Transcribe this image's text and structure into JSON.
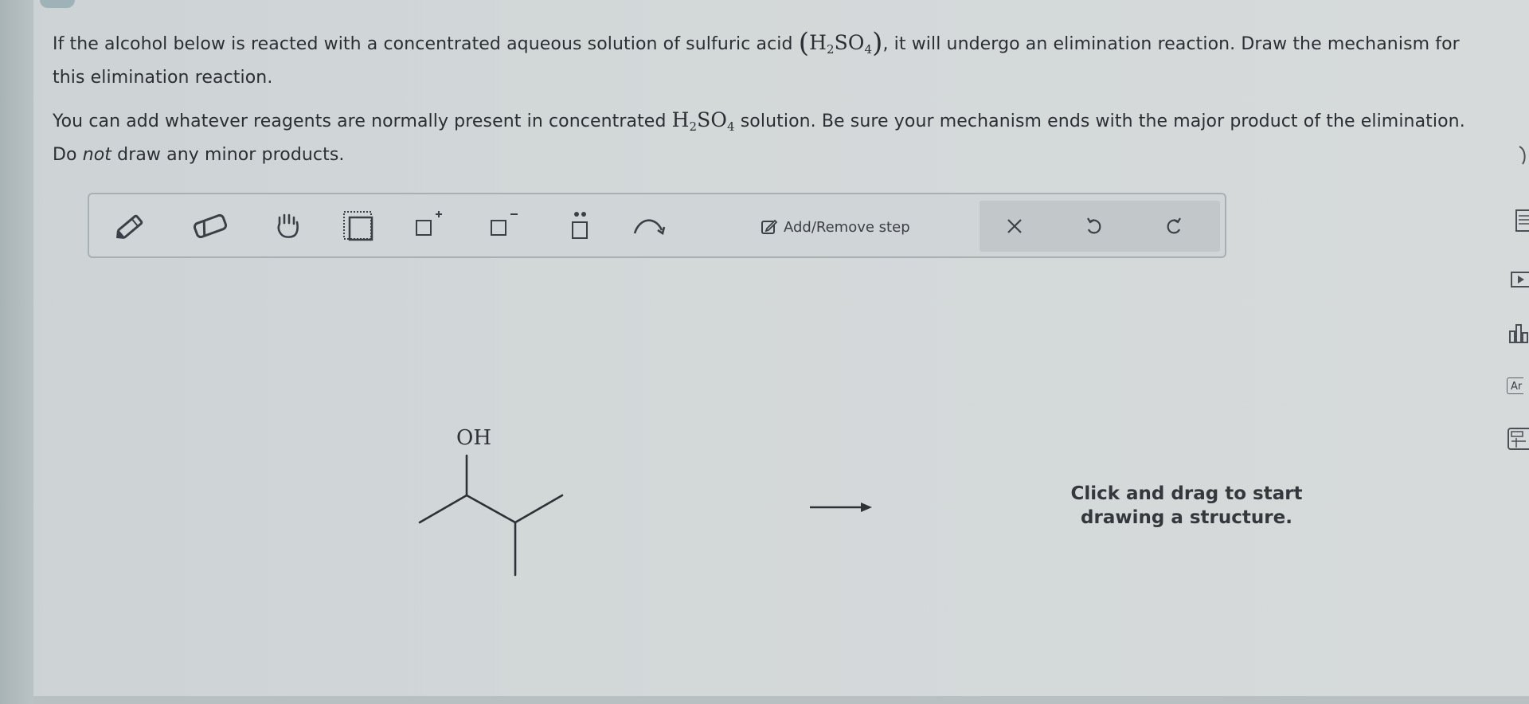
{
  "question": {
    "line1_before": "If the alcohol below is reacted with a concentrated aqueous solution of sulfuric acid ",
    "line1_after": ", it will undergo an elimination reaction. Draw the mechanism for",
    "line2": "this elimination reaction.",
    "para2_before": "You can add whatever reagents are normally present in concentrated ",
    "para2_after": " solution. Be sure your mechanism ends with the major product of the elimination.",
    "para3_before": "Do ",
    "para3_emph": "not",
    "para3_after": " draw any minor products.",
    "acid": {
      "h": "H",
      "h_sub": "2",
      "so": "SO",
      "so_sub": "4"
    }
  },
  "toolbar": {
    "tools": [
      {
        "name": "pencil-tool",
        "icon": "pencil-icon"
      },
      {
        "name": "eraser-tool",
        "icon": "eraser-icon"
      },
      {
        "name": "hand-tool",
        "icon": "hand-icon"
      },
      {
        "name": "select-tool",
        "icon": "select-box-icon"
      },
      {
        "name": "positive-charge-tool",
        "icon": "plus-charge-icon"
      },
      {
        "name": "negative-charge-tool",
        "icon": "minus-charge-icon"
      },
      {
        "name": "lone-pair-tool",
        "icon": "lone-pair-icon"
      },
      {
        "name": "curved-arrow-tool",
        "icon": "curved-arrow-icon"
      }
    ],
    "add_remove_step": "Add/Remove step",
    "actions": [
      {
        "name": "clear-button",
        "icon": "close-icon"
      },
      {
        "name": "undo-button",
        "icon": "undo-icon"
      },
      {
        "name": "redo-button",
        "icon": "redo-icon"
      }
    ]
  },
  "canvas": {
    "oh_label": "OH",
    "hint_line1": "Click and drag to start",
    "hint_line2": "drawing a structure."
  },
  "side_tools": {
    "ar_label": "Ar"
  }
}
